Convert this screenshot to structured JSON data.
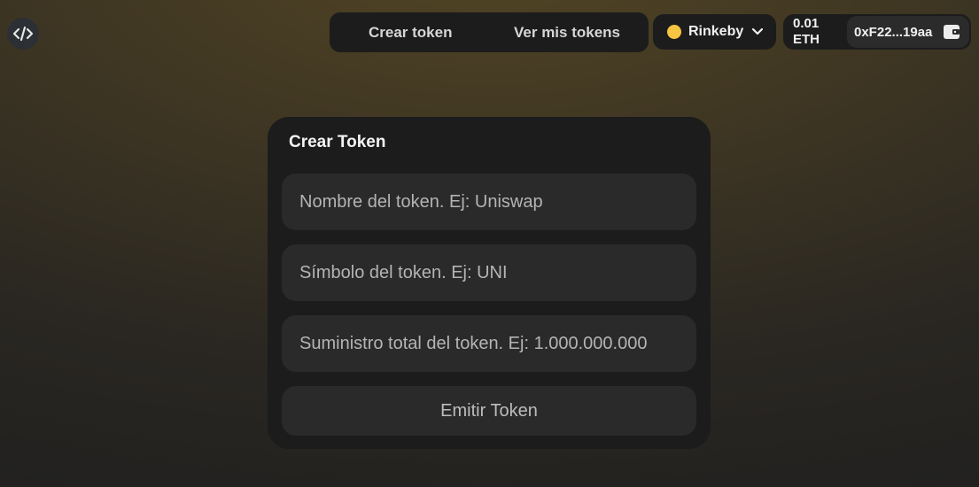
{
  "header": {
    "logo_icon": "code-brackets-icon",
    "nav": [
      {
        "label": "Crear token"
      },
      {
        "label": "Ver mis tokens"
      }
    ],
    "network": {
      "label": "Rinkeby",
      "status_color": "#f5c542",
      "chevron_icon": "chevron-down-icon"
    },
    "wallet": {
      "balance_amount": "0.01",
      "balance_unit": "ETH",
      "address": "0xF22...19aa",
      "wallet_icon": "wallet-icon"
    }
  },
  "form": {
    "title": "Crear Token",
    "name_placeholder": "Nombre del token. Ej: Uniswap",
    "symbol_placeholder": "Símbolo del token. Ej: UNI",
    "supply_placeholder": "Suministro total del token. Ej: 1.000.000.000",
    "submit_label": "Emitir Token"
  },
  "colors": {
    "card_bg": "#1c1c1c",
    "field_bg": "#2a2a2a",
    "network_dot": "#f5c542"
  }
}
